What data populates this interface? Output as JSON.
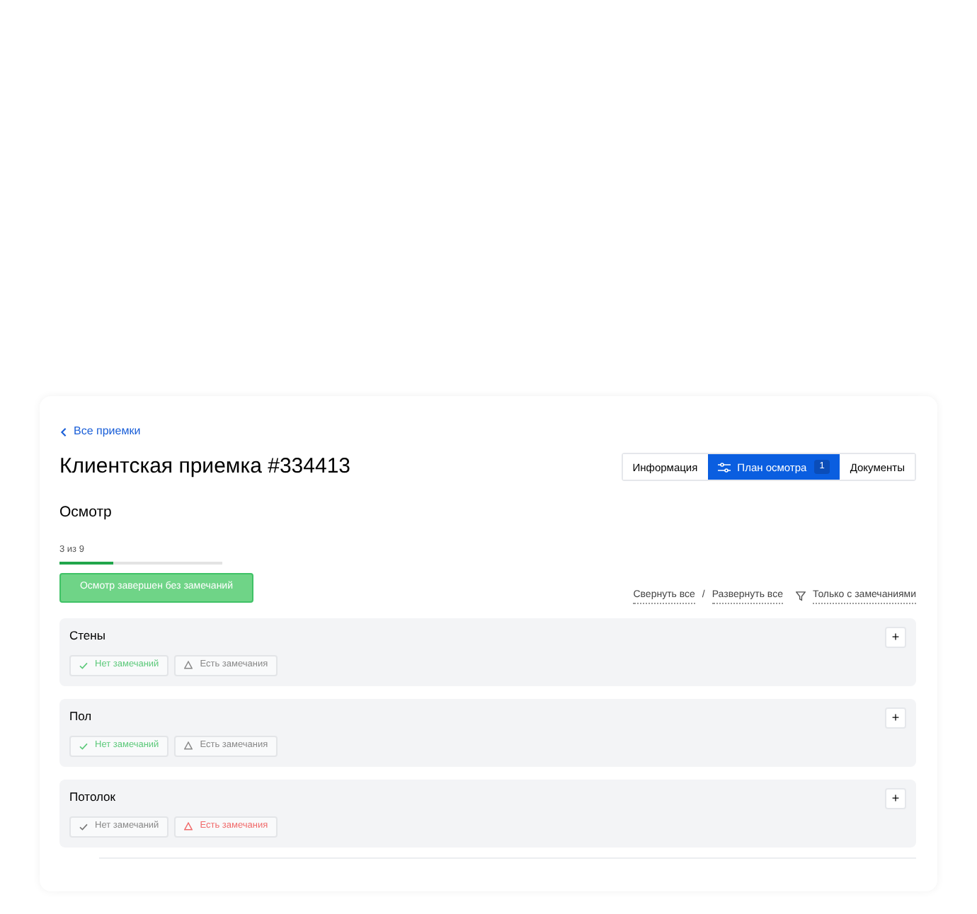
{
  "back_link": "Все приемки",
  "title": "Клиентская приемка #334413",
  "tabs": [
    {
      "label": "Информация",
      "selected": false
    },
    {
      "label": "План осмотра",
      "selected": true,
      "badge": "1"
    },
    {
      "label": "Документы",
      "selected": false
    }
  ],
  "section_title": "Осмотр",
  "progress": {
    "reading": "3 из 9",
    "level": 0.33
  },
  "complete_button": "Осмотр завершен без замечаний",
  "actions": {
    "collapse": "Свернуть все",
    "separator": "/",
    "expand": "Развернуть все",
    "filter": "Только с замечаниями"
  },
  "items": [
    {
      "name": "Стены",
      "ok_label": "Нет замечаний",
      "issues_label": "Есть замечания",
      "ok_selected": true,
      "issues_selected": false
    },
    {
      "name": "Пол",
      "ok_label": "Нет замечаний",
      "issues_label": "Есть замечания",
      "ok_selected": true,
      "issues_selected": false
    },
    {
      "name": "Потолок",
      "ok_label": "Нет замечаний",
      "issues_label": "Есть замечания",
      "ok_selected": false,
      "issues_selected": true
    }
  ],
  "add_label": "+"
}
